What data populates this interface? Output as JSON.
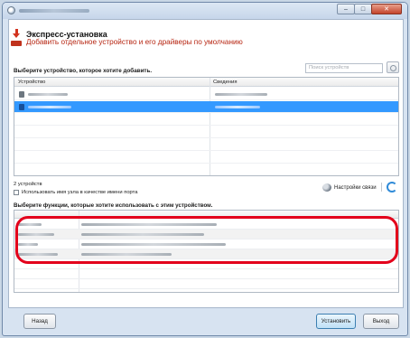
{
  "window": {
    "title": "",
    "controls": [
      "–",
      "□",
      "✕"
    ]
  },
  "header": {
    "title": "Экспресс-установка",
    "subtitle": "Добавить отдельное устройство и его драйверы по умолчанию"
  },
  "device_section": {
    "instruction": "Выберите устройство, которое хотите добавить.",
    "search_placeholder": "Поиск устройств",
    "columns": [
      "Устройство",
      "Сведения"
    ],
    "rows": [
      {
        "device": "",
        "details": "",
        "selected": false
      },
      {
        "device": "",
        "details": "",
        "selected": true
      }
    ],
    "count_label": "2 устройств",
    "checkbox_label": "Использовать имя узла в качестве имени порта",
    "checkbox_checked": false,
    "connection_settings_label": "Настройки связи"
  },
  "function_section": {
    "instruction": "Выберите функции, которые хотите использовать с этим устройством.",
    "columns": [
      "",
      ""
    ],
    "rows": [
      {
        "name": "",
        "description": ""
      },
      {
        "name": "",
        "description": ""
      },
      {
        "name": "",
        "description": ""
      },
      {
        "name": "",
        "description": ""
      }
    ]
  },
  "footer": {
    "back_label": "Назад",
    "install_label": "Установить",
    "exit_label": "Выход"
  },
  "colors": {
    "accent_red": "#d2321e",
    "selection_blue": "#3399ff",
    "highlight_red": "#e3001b"
  }
}
